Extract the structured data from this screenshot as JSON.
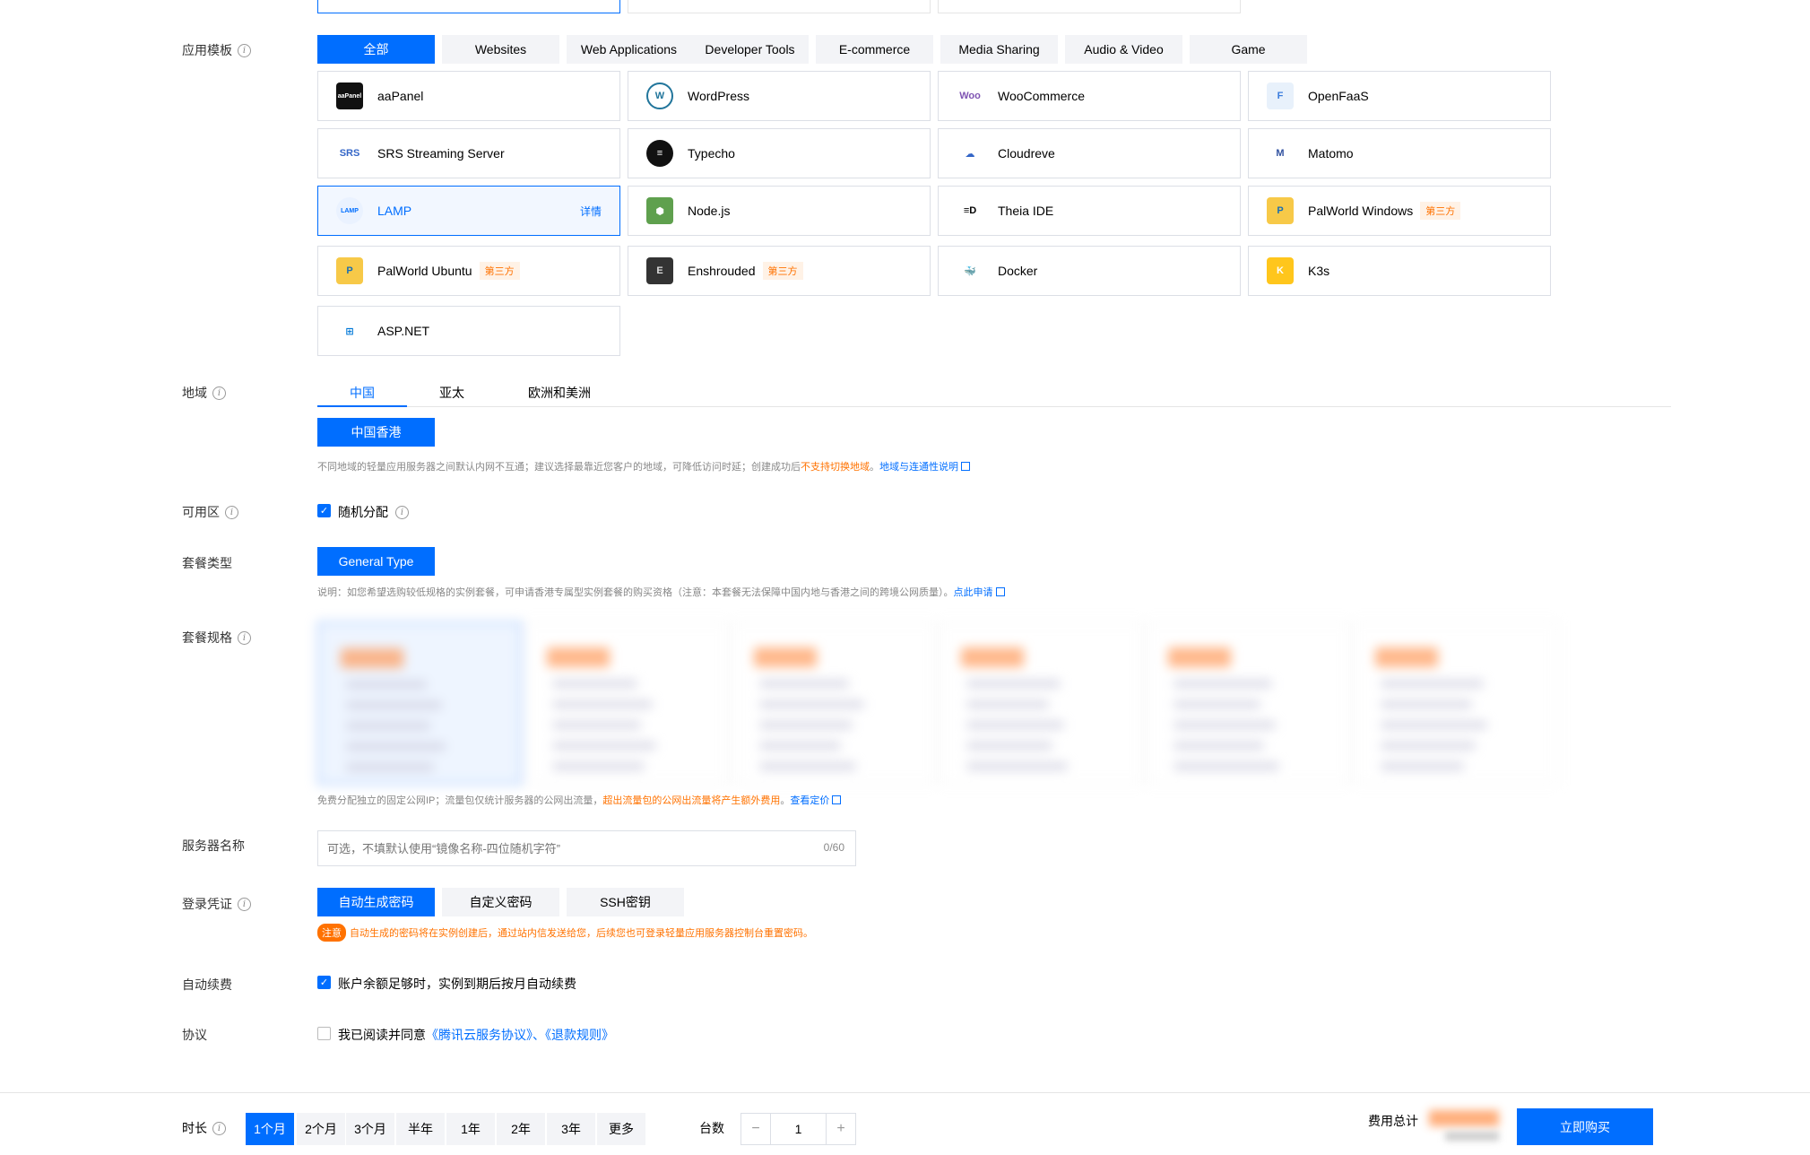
{
  "template": {
    "label": "应用模板",
    "categories": [
      "全部",
      "Websites",
      "Web Applications",
      "Developer Tools",
      "E-commerce",
      "Media Sharing",
      "Audio & Video",
      "Game"
    ],
    "apps": [
      {
        "name": "aaPanel",
        "logo": "aaPanel",
        "third": false
      },
      {
        "name": "WordPress",
        "logo": "W",
        "third": false
      },
      {
        "name": "WooCommerce",
        "logo": "Woo",
        "third": false
      },
      {
        "name": "OpenFaaS",
        "logo": "F",
        "third": false
      },
      {
        "name": "SRS Streaming Server",
        "logo": "SRS",
        "third": false
      },
      {
        "name": "Typecho",
        "logo": "≡",
        "third": false
      },
      {
        "name": "Cloudreve",
        "logo": "☁",
        "third": false
      },
      {
        "name": "Matomo",
        "logo": "M",
        "third": false
      },
      {
        "name": "LAMP",
        "logo": "LAMP",
        "third": false
      },
      {
        "name": "Node.js",
        "logo": "⬢",
        "third": false
      },
      {
        "name": "Theia IDE",
        "logo": "≡D",
        "third": false
      },
      {
        "name": "PalWorld Windows",
        "logo": "P",
        "third": true
      },
      {
        "name": "PalWorld Ubuntu",
        "logo": "P",
        "third": true
      },
      {
        "name": "Enshrouded",
        "logo": "E",
        "third": true
      },
      {
        "name": "Docker",
        "logo": "🐳",
        "third": false
      },
      {
        "name": "K3s",
        "logo": "K",
        "third": false
      },
      {
        "name": "ASP.NET",
        "logo": "⊞",
        "third": false
      }
    ],
    "third_tag": "第三方",
    "detail_link": "详情"
  },
  "region": {
    "label": "地域",
    "tabs": [
      "中国",
      "亚太",
      "欧洲和美洲"
    ],
    "selected_city": "中国香港",
    "hint_prefix": "不同地域的轻量应用服务器之间默认内网不互通；建议选择最靠近您客户的地域，可降低访问时延；创建成功后",
    "hint_orange": "不支持切换地域",
    "hint_sep": "。",
    "hint_link": "地域与连通性说明"
  },
  "zone": {
    "label": "可用区",
    "option": "随机分配"
  },
  "plan_type": {
    "label": "套餐类型",
    "option": "General Type",
    "hint_prefix": "说明：如您希望选购较低规格的实例套餐，可申请香港专属型实例套餐的购买资格（注意：本套餐无法保障中国内地与香港之间的跨境公网质量）。",
    "hint_link": "点此申请"
  },
  "plan_spec": {
    "label": "套餐规格",
    "hint_prefix": "免费分配独立的固定公网IP；流量包仅统计服务器的公网出流量，",
    "hint_orange": "超出流量包的公网出流量将产生额外费用",
    "hint_sep": "。",
    "hint_link": "查看定价"
  },
  "server_name": {
    "label": "服务器名称",
    "placeholder": "可选，不填默认使用“镜像名称-四位随机字符”",
    "counter": "0/60"
  },
  "credential": {
    "label": "登录凭证",
    "options": [
      "自动生成密码",
      "自定义密码",
      "SSH密钥"
    ],
    "notice_tag": "注意",
    "notice": "自动生成的密码将在实例创建后，通过站内信发送给您，后续您也可登录轻量应用服务器控制台重置密码。"
  },
  "auto_renew": {
    "label": "自动续费",
    "option": "账户余额足够时，实例到期后按月自动续费"
  },
  "agreement": {
    "label": "协议",
    "prefix": "我已阅读并同意",
    "link": "《腾讯云服务协议》、《退款规则》"
  },
  "footer": {
    "duration_label": "时长",
    "durations": [
      "1个月",
      "2个月",
      "3个月",
      "半年",
      "1年",
      "2年",
      "3年",
      "更多"
    ],
    "count_label": "台数",
    "count_value": "1",
    "minus": "−",
    "plus": "+",
    "total_label": "费用总计",
    "buy_button": "立即购买"
  },
  "colors": {
    "primary": "#006eff",
    "warning": "#ff7200"
  }
}
